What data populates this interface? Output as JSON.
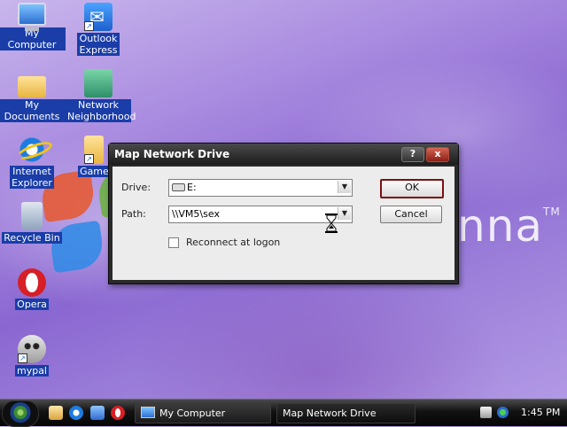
{
  "desktop": {
    "wallpaper_text": "nna",
    "wallpaper_mark": "TM",
    "icons": [
      {
        "label": "My Computer",
        "icon": "my-computer-icon"
      },
      {
        "label": "Outlook Express",
        "icon": "outlook-express-icon"
      },
      {
        "label": "My Documents",
        "icon": "my-documents-icon"
      },
      {
        "label": "Network Neighborhood",
        "icon": "network-neighborhood-icon"
      },
      {
        "label": "Internet Explorer",
        "icon": "internet-explorer-icon"
      },
      {
        "label": "Game",
        "icon": "game-icon"
      },
      {
        "label": "Recycle Bin",
        "icon": "recycle-bin-icon"
      },
      {
        "label": "Opera",
        "icon": "opera-icon"
      },
      {
        "label": "mypal",
        "icon": "mypal-icon"
      }
    ]
  },
  "dialog": {
    "title": "Map Network Drive",
    "help_button": "?",
    "close_button": "x",
    "drive_label": "Drive:",
    "drive_value": "E:",
    "path_label": "Path:",
    "path_value": "\\\\VM5\\sex",
    "reconnect_label": "Reconnect at logon",
    "reconnect_checked": false,
    "ok_label": "OK",
    "cancel_label": "Cancel"
  },
  "taskbar": {
    "tasks": [
      "My Computer",
      "Map Network Drive"
    ],
    "clock": "1:45 PM"
  }
}
